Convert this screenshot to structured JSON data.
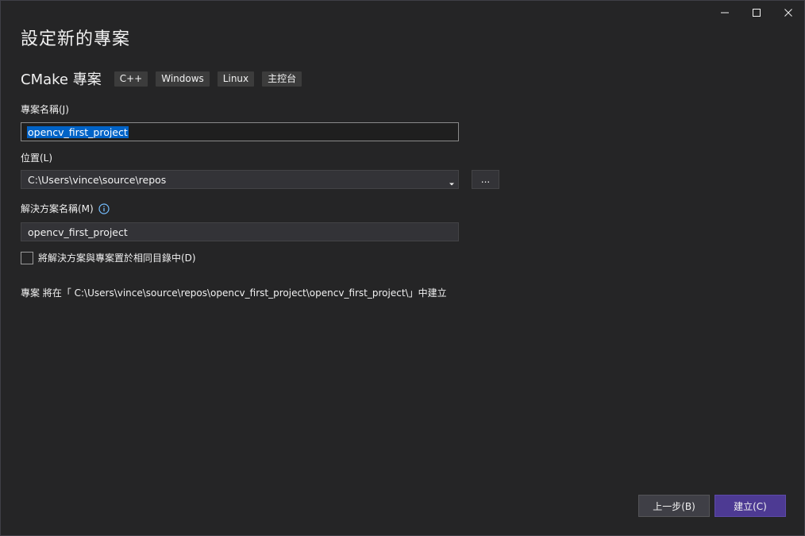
{
  "window": {
    "title": "設定新的專案",
    "controls": {
      "minimize": "minimize-icon",
      "maximize": "maximize-icon",
      "close": "close-icon"
    }
  },
  "template": {
    "name": "CMake 專案",
    "tags": [
      "C++",
      "Windows",
      "Linux",
      "主控台"
    ]
  },
  "project_name": {
    "label": "專案名稱(J)",
    "value": "opencv_first_project"
  },
  "location": {
    "label": "位置(L)",
    "value": "C:\\Users\\vince\\source\\repos",
    "browse_label": "..."
  },
  "solution_name": {
    "label": "解決方案名稱(M)",
    "value": "opencv_first_project"
  },
  "same_directory": {
    "label": "將解決方案與專案置於相同目錄中(D)",
    "checked": false
  },
  "path_info": "專案 將在「 C:\\Users\\vince\\source\\repos\\opencv_first_project\\opencv_first_project\\」中建立",
  "buttons": {
    "back": "上一步(B)",
    "create": "建立(C)"
  },
  "colors": {
    "background": "#252526",
    "accent_button": "#4d3a93",
    "selection": "#0063c7",
    "info_icon": "#75beff"
  }
}
